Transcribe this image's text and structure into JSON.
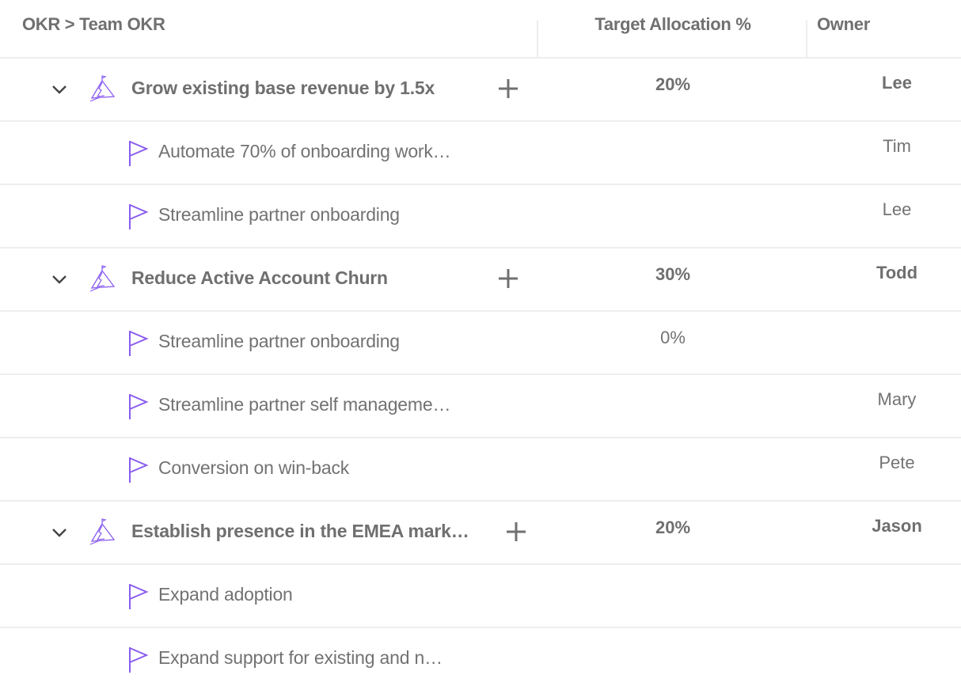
{
  "header": {
    "breadcrumb": "OKR > Team OKR",
    "col_target": "Target Allocation %",
    "col_owner": "Owner"
  },
  "colors": {
    "accent_purple": "#8a5cf0",
    "text_gray": "#737373",
    "divider": "#eeeeee"
  },
  "icons": {
    "objective": "mountain-flag-icon",
    "key_result": "flag-icon",
    "expand": "chevron-down-icon",
    "add": "plus-icon"
  },
  "rows": [
    {
      "type": "objective",
      "title": "Grow existing base revenue by 1.5x",
      "target": "20%",
      "owner": "Lee"
    },
    {
      "type": "kr",
      "title": "Automate 70% of onboarding work…",
      "target": "",
      "owner": "Tim"
    },
    {
      "type": "kr",
      "title": "Streamline partner onboarding",
      "target": "",
      "owner": "Lee"
    },
    {
      "type": "objective",
      "title": "Reduce Active Account Churn",
      "target": "30%",
      "owner": "Todd"
    },
    {
      "type": "kr",
      "title": "Streamline partner onboarding",
      "target": "0%",
      "owner": ""
    },
    {
      "type": "kr",
      "title": "Streamline partner self manageme…",
      "target": "",
      "owner": "Mary"
    },
    {
      "type": "kr",
      "title": "Conversion on win-back",
      "target": "",
      "owner": "Pete"
    },
    {
      "type": "objective",
      "title": "Establish presence in the EMEA mark…",
      "target": "20%",
      "owner": "Jason"
    },
    {
      "type": "kr",
      "title": "Expand adoption",
      "target": "",
      "owner": ""
    },
    {
      "type": "kr",
      "title": "Expand support for existing and n…",
      "target": "",
      "owner": ""
    }
  ]
}
